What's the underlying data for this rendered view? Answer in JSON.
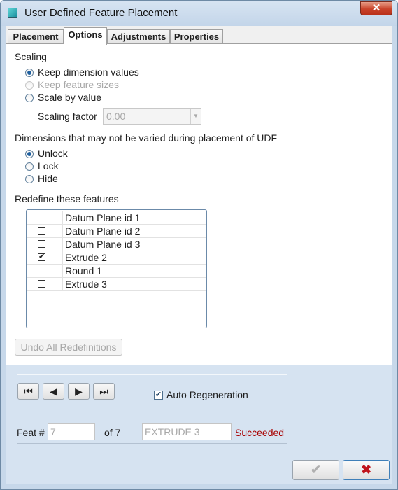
{
  "window": {
    "title": "User Defined Feature Placement",
    "close_glyph": "✕"
  },
  "tabs": [
    {
      "label": "Placement",
      "active": false
    },
    {
      "label": "Options",
      "active": true
    },
    {
      "label": "Adjustments",
      "active": false
    },
    {
      "label": "Properties",
      "active": false
    }
  ],
  "options": {
    "scaling": {
      "heading": "Scaling",
      "choices": [
        {
          "label": "Keep dimension values",
          "selected": true,
          "disabled": false
        },
        {
          "label": "Keep feature sizes",
          "selected": false,
          "disabled": true
        },
        {
          "label": "Scale by value",
          "selected": false,
          "disabled": false
        }
      ],
      "factor_label": "Scaling factor",
      "factor_value": "0.00"
    },
    "dimensions": {
      "heading": "Dimensions that may not be varied during placement of UDF",
      "choices": [
        {
          "label": "Unlock",
          "selected": true
        },
        {
          "label": "Lock",
          "selected": false
        },
        {
          "label": "Hide",
          "selected": false
        }
      ]
    },
    "redefine": {
      "heading": "Redefine these features",
      "features": [
        {
          "name": "Datum Plane id 1",
          "checked": false
        },
        {
          "name": "Datum Plane id 2",
          "checked": false
        },
        {
          "name": "Datum Plane id 3",
          "checked": false
        },
        {
          "name": "Extrude 2",
          "checked": true
        },
        {
          "name": "Round 1",
          "checked": false
        },
        {
          "name": "Extrude 3",
          "checked": false
        }
      ],
      "undo_label": "Undo All Redefinitions"
    }
  },
  "bottom": {
    "nav": {
      "first": "⏮",
      "prev": "◀",
      "next": "▶",
      "last": "⏭"
    },
    "auto_regeneration": {
      "label": "Auto Regeneration",
      "checked": true
    },
    "feat_label": "Feat #",
    "feat_number": "7",
    "of_label": "of 7",
    "feature_name": "EXTRUDE 3",
    "status": "Succeeded",
    "status_color": "#a80000"
  },
  "dialog_buttons": {
    "ok_glyph": "✔",
    "cancel_glyph": "✖"
  }
}
